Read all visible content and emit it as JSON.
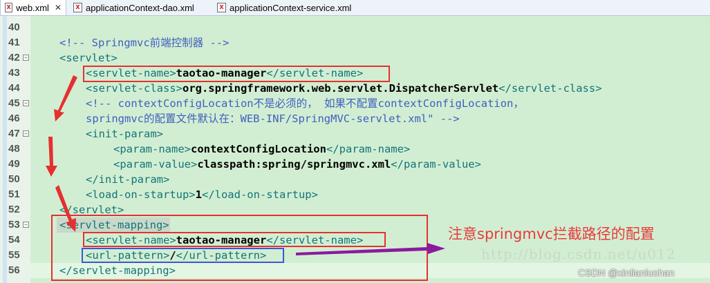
{
  "tabs": [
    {
      "label": "web.xml",
      "active": true
    },
    {
      "label": "applicationContext-dao.xml",
      "active": false
    },
    {
      "label": "applicationContext-service.xml",
      "active": false
    }
  ],
  "lines": [
    {
      "num": "40",
      "fold": false,
      "indent": 0,
      "segments": []
    },
    {
      "num": "41",
      "fold": false,
      "indent": 1,
      "segments": [
        {
          "c": "com",
          "t": "<!-- Springmvc前端控制器 -->"
        }
      ]
    },
    {
      "num": "42",
      "fold": true,
      "indent": 1,
      "segments": [
        {
          "c": "tag",
          "t": "<servlet>"
        }
      ]
    },
    {
      "num": "43",
      "fold": false,
      "indent": 2,
      "segments": [
        {
          "c": "tag",
          "t": "<servlet-name>"
        },
        {
          "c": "txt",
          "t": "taotao-manager"
        },
        {
          "c": "tag",
          "t": "</servlet-name>"
        }
      ]
    },
    {
      "num": "44",
      "fold": false,
      "indent": 2,
      "segments": [
        {
          "c": "tag",
          "t": "<servlet-class>"
        },
        {
          "c": "txt",
          "t": "org.springframework.web.servlet.DispatcherServlet"
        },
        {
          "c": "tag",
          "t": "</servlet-class>"
        }
      ]
    },
    {
      "num": "45",
      "fold": true,
      "indent": 2,
      "segments": [
        {
          "c": "com",
          "t": "<!-- contextConfigLocation不是必须的， 如果不配置contextConfigLocation，"
        }
      ]
    },
    {
      "num": "46",
      "fold": false,
      "indent": 2,
      "segments": [
        {
          "c": "com",
          "t": "springmvc的配置文件默认在：WEB-INF/SpringMVC-servlet.xml\" -->"
        }
      ]
    },
    {
      "num": "47",
      "fold": true,
      "indent": 2,
      "segments": [
        {
          "c": "tag",
          "t": "<init-param>"
        }
      ]
    },
    {
      "num": "48",
      "fold": false,
      "indent": 3,
      "segments": [
        {
          "c": "tag",
          "t": "<param-name>"
        },
        {
          "c": "txt",
          "t": "contextConfigLocation"
        },
        {
          "c": "tag",
          "t": "</param-name>"
        }
      ]
    },
    {
      "num": "49",
      "fold": false,
      "indent": 3,
      "segments": [
        {
          "c": "tag",
          "t": "<param-value>"
        },
        {
          "c": "txt",
          "t": "classpath:spring/springmvc.xml"
        },
        {
          "c": "tag",
          "t": "</param-value>"
        }
      ]
    },
    {
      "num": "50",
      "fold": false,
      "indent": 2,
      "segments": [
        {
          "c": "tag",
          "t": "</init-param>"
        }
      ]
    },
    {
      "num": "51",
      "fold": false,
      "indent": 2,
      "segments": [
        {
          "c": "tag",
          "t": "<load-on-startup>"
        },
        {
          "c": "txt",
          "t": "1"
        },
        {
          "c": "tag",
          "t": "</load-on-startup>"
        }
      ]
    },
    {
      "num": "52",
      "fold": false,
      "indent": 1,
      "segments": [
        {
          "c": "tag",
          "t": "</servlet>"
        }
      ]
    },
    {
      "num": "53",
      "fold": true,
      "indent": 1,
      "segments": [
        {
          "c": "tag",
          "t": "<servlet-mapping>"
        }
      ]
    },
    {
      "num": "54",
      "fold": false,
      "indent": 2,
      "segments": [
        {
          "c": "tag",
          "t": "<servlet-name>"
        },
        {
          "c": "txt",
          "t": "taotao-manager"
        },
        {
          "c": "tag",
          "t": "</servlet-name>"
        }
      ]
    },
    {
      "num": "55",
      "fold": false,
      "indent": 2,
      "segments": [
        {
          "c": "tag",
          "t": "<url-pattern>"
        },
        {
          "c": "txt",
          "t": "/"
        },
        {
          "c": "tag",
          "t": "</url-pattern>"
        }
      ]
    },
    {
      "num": "56",
      "fold": false,
      "indent": 1,
      "segments": [
        {
          "c": "tag",
          "t": "</servlet-mapping>"
        }
      ]
    }
  ],
  "annotation": {
    "note": "注意springmvc拦截路径的配置"
  },
  "watermark": {
    "url": "http://blog.csdn.net/u012",
    "credit": "CSDN @xinlianluohan"
  },
  "colors": {
    "tag": "#127478",
    "comment": "#3f5fbf",
    "annotation_red": "#e53030",
    "annotation_blue": "#3a57d6",
    "arrow_purple": "#8a1a9e"
  }
}
